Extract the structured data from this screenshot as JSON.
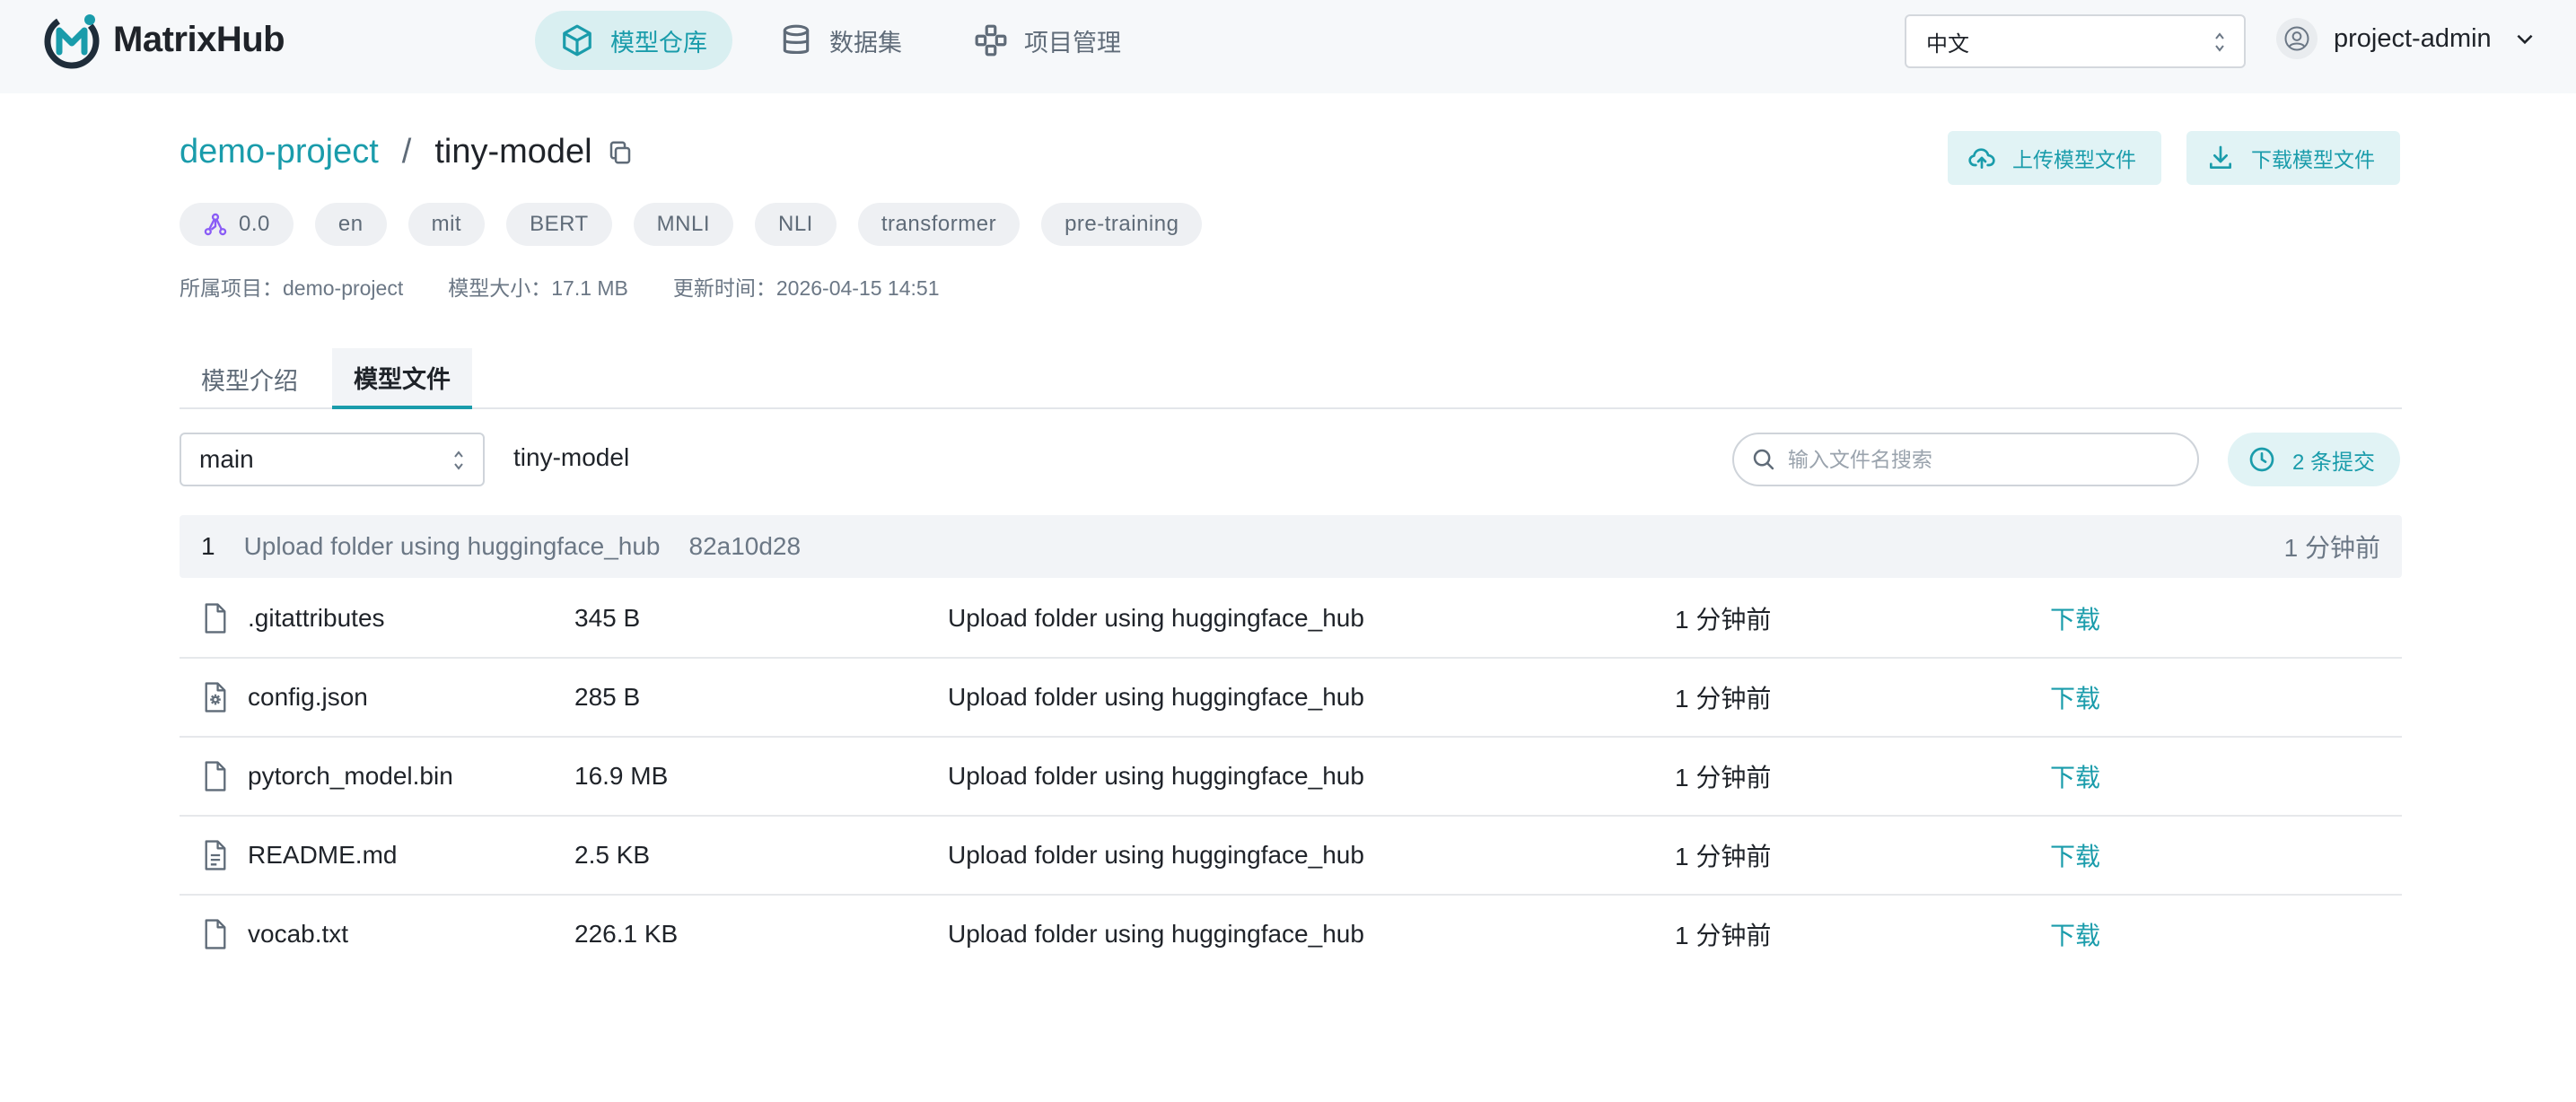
{
  "app": {
    "name": "MatrixHub"
  },
  "nav": [
    {
      "label": "模型仓库",
      "icon": "cube-icon",
      "active": true
    },
    {
      "label": "数据集",
      "icon": "database-icon",
      "active": false
    },
    {
      "label": "项目管理",
      "icon": "modules-icon",
      "active": false
    }
  ],
  "language": {
    "value": "中文"
  },
  "user": {
    "name": "project-admin"
  },
  "repo": {
    "project": "demo-project",
    "separator": "/",
    "model": "tiny-model",
    "upload_label": "上传模型文件",
    "download_label": "下载模型文件",
    "tags": [
      "0.0",
      "en",
      "mit",
      "BERT",
      "MNLI",
      "NLI",
      "transformer",
      "pre-training"
    ],
    "meta": {
      "project": "所属项目：demo-project",
      "size": "模型大小：17.1 MB",
      "updated": "更新时间：2026-04-15 14:51"
    }
  },
  "tabs": [
    {
      "label": "模型介绍",
      "active": false
    },
    {
      "label": "模型文件",
      "active": true
    }
  ],
  "files": {
    "branch": "main",
    "path": "tiny-model",
    "search_placeholder": "输入文件名搜索",
    "commits_label": "2 条提交",
    "latest_commit": {
      "number": "1",
      "message": "Upload folder using huggingface_hub",
      "hash": "82a10d28",
      "time": "1 分钟前"
    },
    "download_label": "下载",
    "rows": [
      {
        "name": ".gitattributes",
        "size": "345 B",
        "message": "Upload folder using huggingface_hub",
        "time": "1 分钟前",
        "icon": "file-icon"
      },
      {
        "name": "config.json",
        "size": "285 B",
        "message": "Upload folder using huggingface_hub",
        "time": "1 分钟前",
        "icon": "config-file-icon"
      },
      {
        "name": "pytorch_model.bin",
        "size": "16.9 MB",
        "message": "Upload folder using huggingface_hub",
        "time": "1 分钟前",
        "icon": "file-icon"
      },
      {
        "name": "README.md",
        "size": "2.5 KB",
        "message": "Upload folder using huggingface_hub",
        "time": "1 分钟前",
        "icon": "text-file-icon"
      },
      {
        "name": "vocab.txt",
        "size": "226.1 KB",
        "message": "Upload folder using huggingface_hub",
        "time": "1 分钟前",
        "icon": "file-icon"
      }
    ]
  },
  "colors": {
    "accent": "#1a9cab",
    "accent_soft": "#e1f3f5",
    "tag_bg": "#eef0f3",
    "header_bg": "#f6f8fa"
  }
}
